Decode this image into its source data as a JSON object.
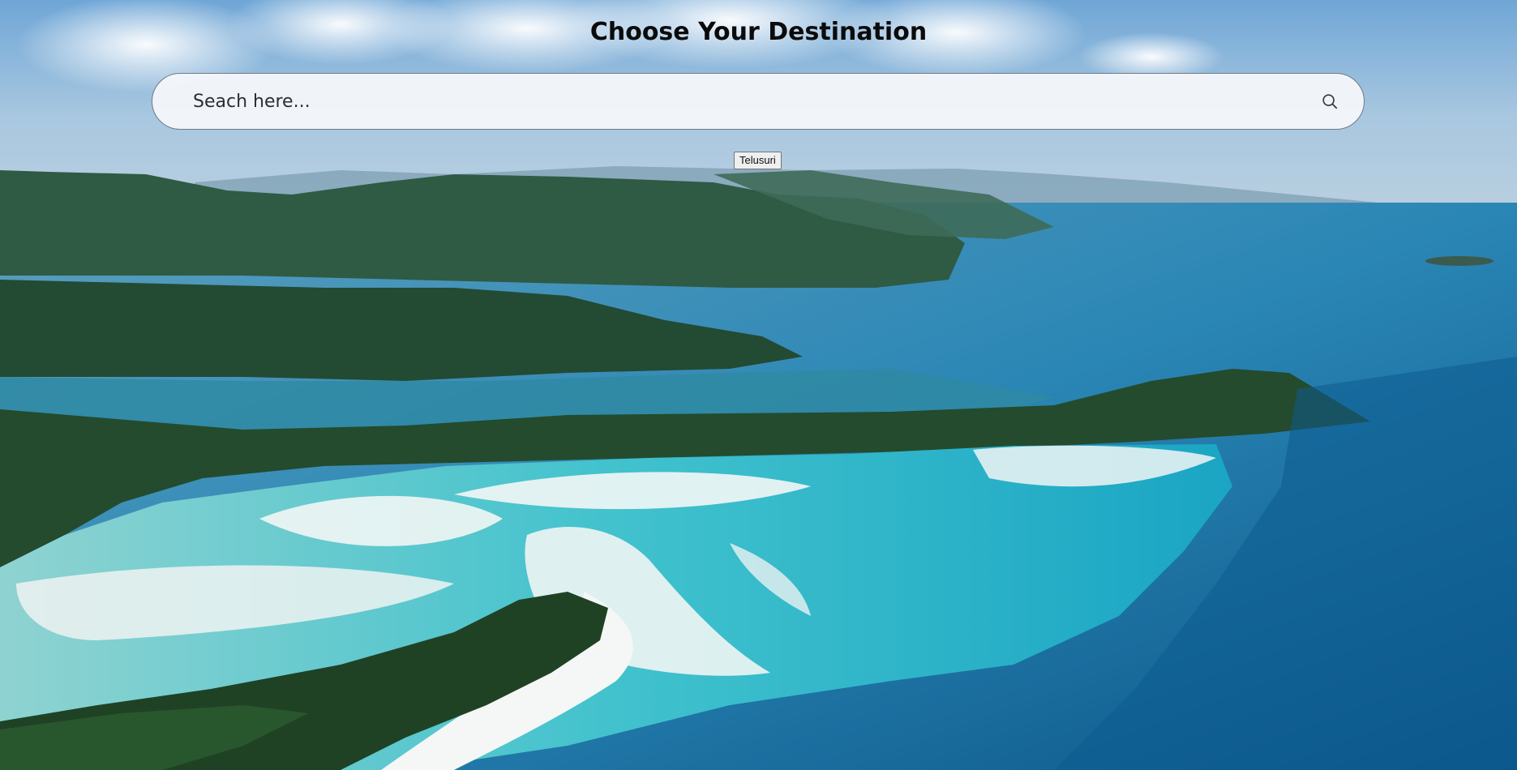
{
  "header": {
    "title": "Choose Your Destination"
  },
  "search": {
    "placeholder": "Seach here...",
    "value": "",
    "icon": "search-icon"
  },
  "actions": {
    "submit_label": "Telusuri"
  },
  "background": {
    "description_icon": "aerial-beach-photo",
    "sky_color": "#8fb8da",
    "sea_color": "#1674a8",
    "lagoon_color": "#3fc3cf",
    "forest_color": "#2a4d31",
    "sand_color": "#eef3f2"
  }
}
